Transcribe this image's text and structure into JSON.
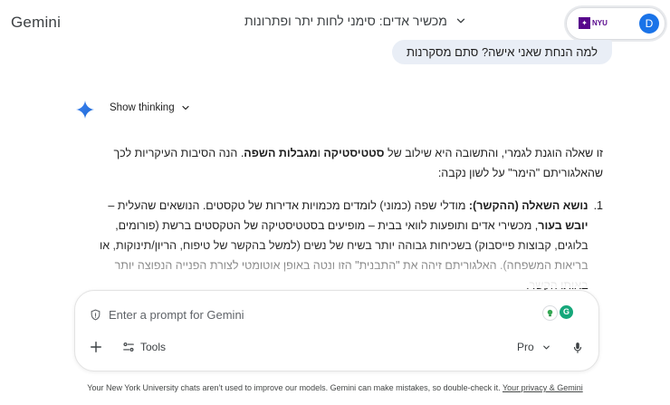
{
  "header": {
    "brand": "Gemini",
    "chat_title": "מכשיר אדים: סימני לחות יתר ופתרונות",
    "account_logo_text": "NYU",
    "avatar_initial": "D"
  },
  "user_message": "למה הנחת שאני אישה? סתם מסקרנות",
  "thinking": {
    "label": "Show thinking"
  },
  "response": {
    "intro_plain": "זו שאלה הוגנת לגמרי, והתשובה היא שילוב של ",
    "intro_bold1": "סטטיסטיקה",
    "intro_mid": " ו",
    "intro_bold2": "מגבלות השפה",
    "intro_end": ". הנה הסיבות העיקריות לכך שהאלגוריתם \"הימר\" על לשון נקבה:",
    "item1_number": "1.",
    "item1_title": "נושא השאלה (ההקשר):",
    "item1_text1": " מודלי שפה (כמוני) לומדים מכמויות אדירות של טקסטים. הנושאים שהעלית – ",
    "item1_bold": "יובש בעור",
    "item1_text2": ", מכשירי אדים ותופעות לוואי בבית – מופיעים בסטטיסטיקה של הטקסטים ברשת (פורומים, בלוגים, קבוצות פייסבוק) בשכיחות גבוהה יותר בשיח של נשים (למשל בהקשר של טיפוח, הריון/תינוקות, או בריאות המשפחה). האלגוריתם זיהה את \"התבנית\" הזו ונטה באופן אוטומטי לצורת הפנייה הנפוצה יותר באותו הקשר."
  },
  "prompt": {
    "placeholder": "Enter a prompt for Gemini",
    "tools_label": "Tools",
    "model_label": "Pro"
  },
  "footer": {
    "text": "Your New York University chats aren’t used to improve our models. Gemini can make mistakes, so double-check it. ",
    "link": "Your privacy & Gemini"
  },
  "colors": {
    "accent": "#1a73e8",
    "user_bubble": "#e9eef6",
    "nyu_purple": "#57068c"
  },
  "icons": [
    "gemini-spark-icon",
    "chevron-down-icon",
    "shield-icon",
    "plus-icon",
    "tools-icon",
    "mic-icon"
  ]
}
